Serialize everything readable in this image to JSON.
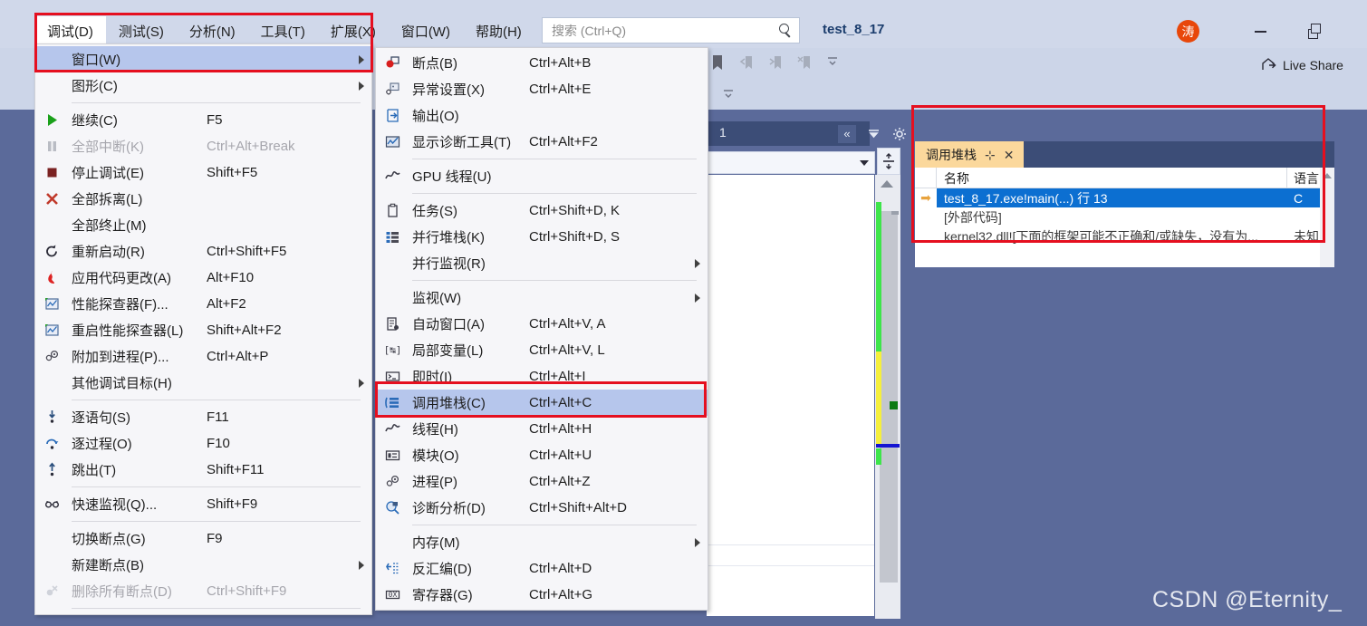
{
  "titlebar": {
    "menus": [
      {
        "label": "调试(D)",
        "active": true
      },
      {
        "label": "测试(S)",
        "active": false
      },
      {
        "label": "分析(N)",
        "active": false
      },
      {
        "label": "工具(T)",
        "active": false
      },
      {
        "label": "扩展(X)",
        "active": false
      },
      {
        "label": "窗口(W)",
        "active": false
      },
      {
        "label": "帮助(H)",
        "active": false
      }
    ],
    "search_placeholder": "搜索 (Ctrl+Q)",
    "project_title": "test_8_17",
    "avatar_initial": "涛",
    "live_share_label": "Live Share",
    "minimize_tooltip": "最小化",
    "restore_tooltip": "还原"
  },
  "editor": {
    "tab_label": "1",
    "collapse_label": "«"
  },
  "call_stack": {
    "title": "调用堆栈",
    "pin": "⊹",
    "close": "✕",
    "columns": [
      "名称",
      "语言"
    ],
    "rows": [
      {
        "marker": "➡",
        "name": "test_8_17.exe!main(...) 行 13",
        "lang": "C",
        "selected": true
      },
      {
        "marker": "",
        "name": "[外部代码]",
        "lang": "",
        "selected": false
      },
      {
        "marker": "",
        "name": "kernel32.dll![下面的框架可能不正确和/或缺失，没有为...",
        "lang": "未知",
        "selected": false
      }
    ]
  },
  "debug_menu": {
    "items": [
      {
        "type": "item",
        "label": "窗口(W)",
        "key": "",
        "submenu": true,
        "highlight": true,
        "icon": ""
      },
      {
        "type": "item",
        "label": "图形(C)",
        "key": "",
        "submenu": true,
        "icon": ""
      },
      {
        "type": "sep"
      },
      {
        "type": "item",
        "label": "继续(C)",
        "key": "F5",
        "icon": "play-icon"
      },
      {
        "type": "item",
        "label": "全部中断(K)",
        "key": "Ctrl+Alt+Break",
        "disabled": true,
        "icon": "pause-icon"
      },
      {
        "type": "item",
        "label": "停止调试(E)",
        "key": "Shift+F5",
        "icon": "stop-icon"
      },
      {
        "type": "item",
        "label": "全部拆离(L)",
        "key": "",
        "icon": "detach-icon"
      },
      {
        "type": "item",
        "label": "全部终止(M)",
        "key": "",
        "icon": ""
      },
      {
        "type": "item",
        "label": "重新启动(R)",
        "key": "Ctrl+Shift+F5",
        "icon": "restart-icon"
      },
      {
        "type": "item",
        "label": "应用代码更改(A)",
        "key": "Alt+F10",
        "icon": "hot-reload-icon"
      },
      {
        "type": "item",
        "label": "性能探查器(F)...",
        "key": "Alt+F2",
        "icon": "profiler-icon"
      },
      {
        "type": "item",
        "label": "重启性能探查器(L)",
        "key": "Shift+Alt+F2",
        "icon": "profiler-restart-icon"
      },
      {
        "type": "item",
        "label": "附加到进程(P)...",
        "key": "Ctrl+Alt+P",
        "icon": "attach-process-icon"
      },
      {
        "type": "item",
        "label": "其他调试目标(H)",
        "key": "",
        "submenu": true,
        "icon": ""
      },
      {
        "type": "sep"
      },
      {
        "type": "item",
        "label": "逐语句(S)",
        "key": "F11",
        "icon": "step-into-icon"
      },
      {
        "type": "item",
        "label": "逐过程(O)",
        "key": "F10",
        "icon": "step-over-icon"
      },
      {
        "type": "item",
        "label": "跳出(T)",
        "key": "Shift+F11",
        "icon": "step-out-icon"
      },
      {
        "type": "sep"
      },
      {
        "type": "item",
        "label": "快速监视(Q)...",
        "key": "Shift+F9",
        "icon": "quick-watch-icon"
      },
      {
        "type": "sep"
      },
      {
        "type": "item",
        "label": "切换断点(G)",
        "key": "F9",
        "icon": ""
      },
      {
        "type": "item",
        "label": "新建断点(B)",
        "key": "",
        "submenu": true,
        "icon": ""
      },
      {
        "type": "item",
        "label": "删除所有断点(D)",
        "key": "Ctrl+Shift+F9",
        "disabled": true,
        "icon": "delete-breakpoints-icon"
      },
      {
        "type": "sep"
      }
    ]
  },
  "window_submenu": {
    "items": [
      {
        "type": "item",
        "label": "断点(B)",
        "key": "Ctrl+Alt+B",
        "icon": "breakpoint-icon"
      },
      {
        "type": "item",
        "label": "异常设置(X)",
        "key": "Ctrl+Alt+E",
        "icon": "exception-settings-icon"
      },
      {
        "type": "item",
        "label": "输出(O)",
        "key": "",
        "icon": "output-icon"
      },
      {
        "type": "item",
        "label": "显示诊断工具(T)",
        "key": "Ctrl+Alt+F2",
        "icon": "diagnostic-tools-icon"
      },
      {
        "type": "sep"
      },
      {
        "type": "item",
        "label": "GPU 线程(U)",
        "key": "",
        "icon": "gpu-threads-icon"
      },
      {
        "type": "sep"
      },
      {
        "type": "item",
        "label": "任务(S)",
        "key": "Ctrl+Shift+D, K",
        "icon": "tasks-icon"
      },
      {
        "type": "item",
        "label": "并行堆栈(K)",
        "key": "Ctrl+Shift+D, S",
        "icon": "parallel-stacks-icon"
      },
      {
        "type": "item",
        "label": "并行监视(R)",
        "key": "",
        "submenu": true,
        "icon": ""
      },
      {
        "type": "sep"
      },
      {
        "type": "item",
        "label": "监视(W)",
        "key": "",
        "submenu": true,
        "icon": ""
      },
      {
        "type": "item",
        "label": "自动窗口(A)",
        "key": "Ctrl+Alt+V, A",
        "icon": "autos-icon"
      },
      {
        "type": "item",
        "label": "局部变量(L)",
        "key": "Ctrl+Alt+V, L",
        "icon": "locals-icon"
      },
      {
        "type": "item",
        "label": "即时(I)",
        "key": "Ctrl+Alt+I",
        "icon": "immediate-icon"
      },
      {
        "type": "item",
        "label": "调用堆栈(C)",
        "key": "Ctrl+Alt+C",
        "icon": "call-stack-icon",
        "highlight": true
      },
      {
        "type": "item",
        "label": "线程(H)",
        "key": "Ctrl+Alt+H",
        "icon": "threads-icon"
      },
      {
        "type": "item",
        "label": "模块(O)",
        "key": "Ctrl+Alt+U",
        "icon": "modules-icon"
      },
      {
        "type": "item",
        "label": "进程(P)",
        "key": "Ctrl+Alt+Z",
        "icon": "processes-icon"
      },
      {
        "type": "item",
        "label": "诊断分析(D)",
        "key": "Ctrl+Shift+Alt+D",
        "icon": "diagnostic-analysis-icon"
      },
      {
        "type": "sep"
      },
      {
        "type": "item",
        "label": "内存(M)",
        "key": "",
        "submenu": true,
        "icon": ""
      },
      {
        "type": "item",
        "label": "反汇编(D)",
        "key": "Ctrl+Alt+D",
        "icon": "disassembly-icon"
      },
      {
        "type": "item",
        "label": "寄存器(G)",
        "key": "Ctrl+Alt+G",
        "icon": "registers-icon"
      }
    ]
  },
  "watermark": {
    "text": "CSDN @Eternity_"
  },
  "colors": {
    "accent_highlight": "#b6c6ec",
    "annotation_red": "#e50f1f",
    "selection_blue": "#0c6fd1",
    "tab_orange": "#fbd89c",
    "marker_green": "#3ee54b",
    "marker_yellow": "#f5ef3c"
  }
}
